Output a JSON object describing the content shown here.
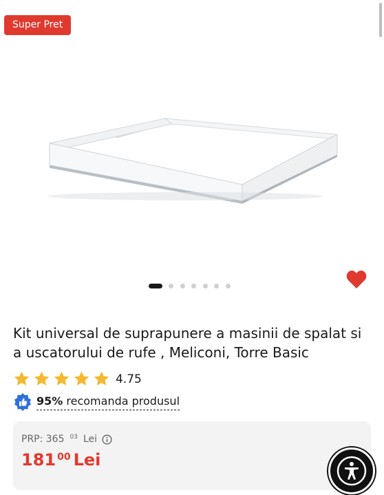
{
  "badge": {
    "label": "Super Pret"
  },
  "gallery": {
    "total_dots": 7,
    "active_index": 0,
    "image_alt_icon": "washing-machine-stacking-kit-image"
  },
  "product": {
    "title": "Kit universal de suprapunere a masinii de spalat si a uscatorului de rufe , Meliconi, Torre Basic"
  },
  "rating": {
    "stars": 5,
    "value": "4.75"
  },
  "recommend": {
    "percent": "95%",
    "text": "recomanda produsul"
  },
  "price": {
    "prp_label": "PRP: 365",
    "prp_decimals": "03",
    "prp_currency": "Lei",
    "current_int": "181",
    "current_decimals": "00",
    "current_currency": "Lei"
  },
  "colors": {
    "accent": "#e03a2f",
    "star": "#f5b82e",
    "thumb": "#2f6fdd"
  },
  "icons": {
    "favorite": "heart-icon",
    "info": "info-icon",
    "recommend": "thumbs-up-icon",
    "accessibility": "accessibility-icon"
  }
}
